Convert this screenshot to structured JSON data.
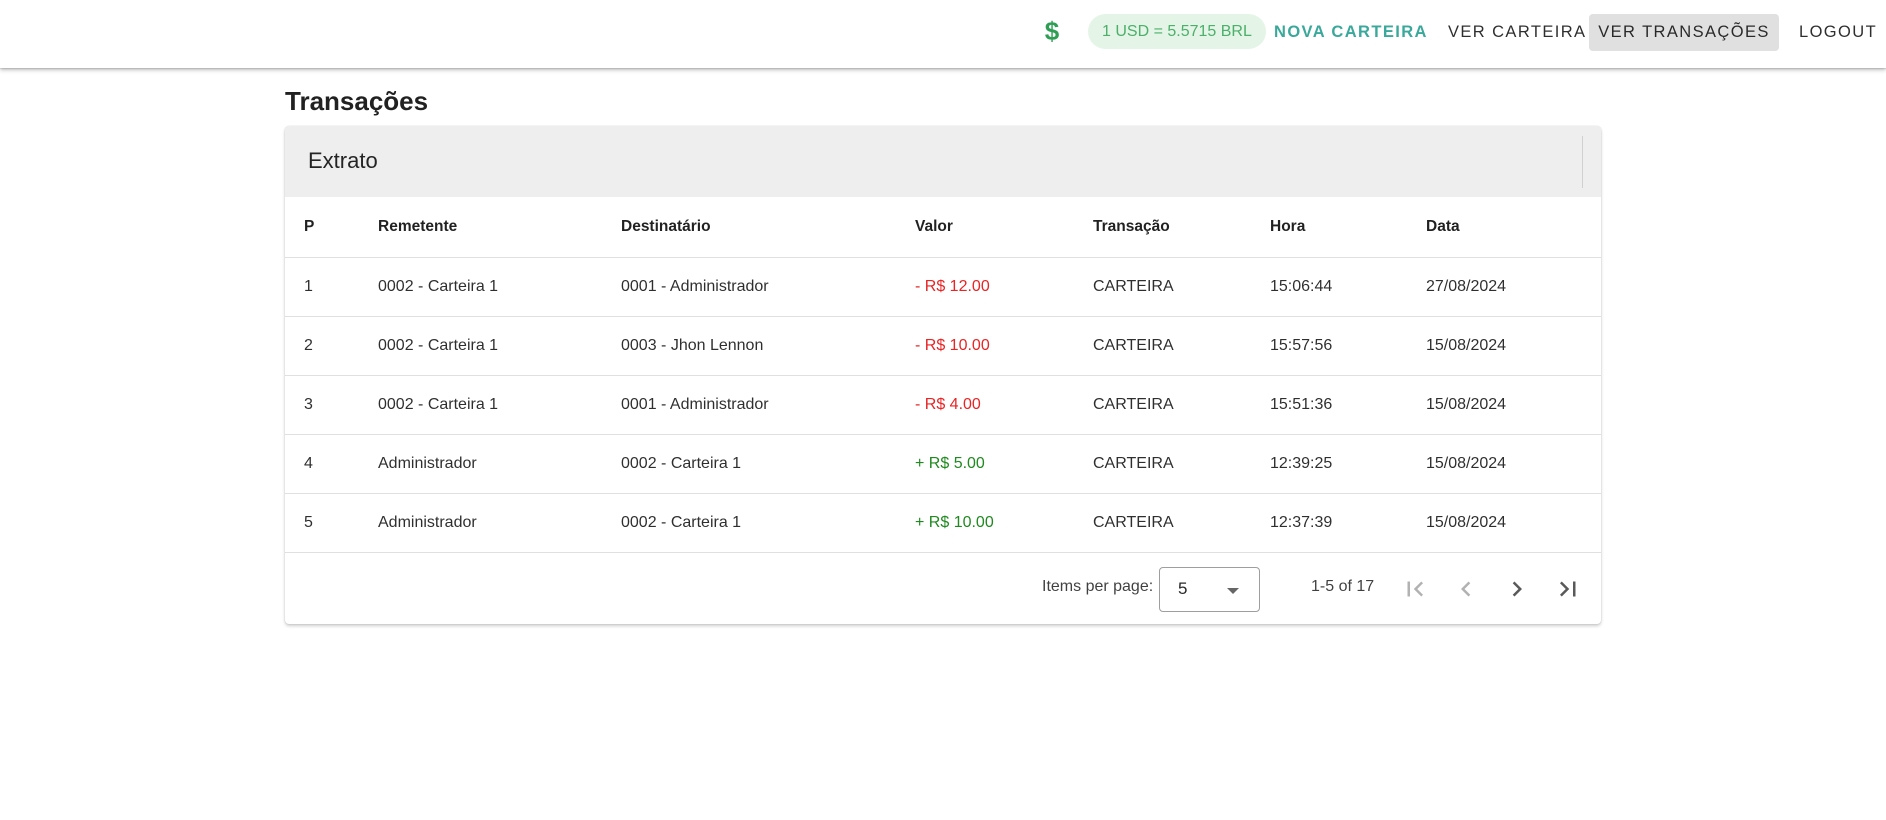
{
  "toolbar": {
    "currency_icon": "dollar-icon",
    "rate_text": "1 USD = 5.5715 BRL",
    "nav": {
      "nova_carteira": "NOVA CARTEIRA",
      "ver_carteira": "VER CARTEIRA",
      "ver_transacoes": "VER TRANSAÇÕES",
      "logout": "LOGOUT"
    }
  },
  "page": {
    "title": "Transações"
  },
  "card": {
    "header_title": "Extrato"
  },
  "table": {
    "columns": [
      "P",
      "Remetente",
      "Destinatário",
      "Valor",
      "Transação",
      "Hora",
      "Data"
    ],
    "rows": [
      {
        "p": "1",
        "remetente": "0002 - Carteira 1",
        "destinatario": "0001 - Administrador",
        "valor": "- R$ 12.00",
        "sign": "neg",
        "transacao": "CARTEIRA",
        "hora": "15:06:44",
        "data": "27/08/2024"
      },
      {
        "p": "2",
        "remetente": "0002 - Carteira 1",
        "destinatario": "0003 - Jhon Lennon",
        "valor": "- R$ 10.00",
        "sign": "neg",
        "transacao": "CARTEIRA",
        "hora": "15:57:56",
        "data": "15/08/2024"
      },
      {
        "p": "3",
        "remetente": "0002 - Carteira 1",
        "destinatario": "0001 - Administrador",
        "valor": "- R$ 4.00",
        "sign": "neg",
        "transacao": "CARTEIRA",
        "hora": "15:51:36",
        "data": "15/08/2024"
      },
      {
        "p": "4",
        "remetente": "Administrador",
        "destinatario": "0002 - Carteira 1",
        "valor": "+ R$ 5.00",
        "sign": "pos",
        "transacao": "CARTEIRA",
        "hora": "12:39:25",
        "data": "15/08/2024"
      },
      {
        "p": "5",
        "remetente": "Administrador",
        "destinatario": "0002 - Carteira 1",
        "valor": "+ R$ 10.00",
        "sign": "pos",
        "transacao": "CARTEIRA",
        "hora": "12:37:39",
        "data": "15/08/2024"
      }
    ]
  },
  "paginator": {
    "items_per_page_label": "Items per page:",
    "items_per_page_value": "5",
    "range_label": "1-5 of 17"
  },
  "colors": {
    "accent": "#3aa89a",
    "rate_chip_bg": "#e4f5e7",
    "negative": "#e82424",
    "positive": "#1f8a1f",
    "dollar_icon": "#2e9e55"
  }
}
